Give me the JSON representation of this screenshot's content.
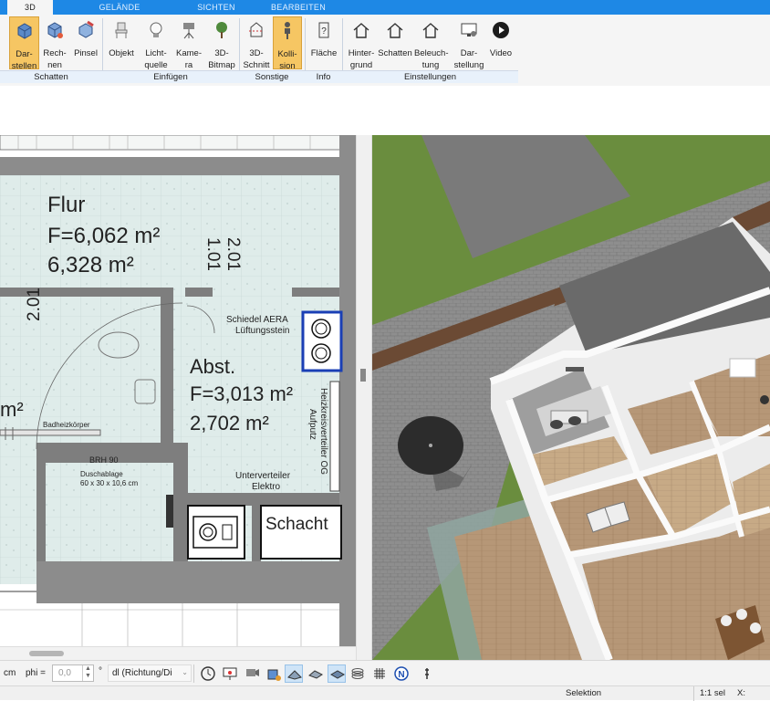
{
  "tabs": [
    {
      "label": "3D",
      "active": true
    },
    {
      "label": "GELÄNDE",
      "active": false
    },
    {
      "label": "SICHTEN",
      "active": false
    },
    {
      "label": "BEARBEITEN",
      "active": false
    }
  ],
  "ribbon": {
    "buttons": [
      {
        "label": "Dar-\nstellen",
        "icon": "cube-render-icon",
        "active": true
      },
      {
        "label": "Rech-\nnen",
        "icon": "cube-calc-icon",
        "active": false
      },
      {
        "label": "Pinsel",
        "icon": "brush-icon",
        "active": false
      },
      {
        "label": "Objekt",
        "icon": "chair-icon",
        "active": false
      },
      {
        "label": "Licht-\nquelle ▼",
        "icon": "bulb-icon",
        "active": false
      },
      {
        "label": "Kame-\nra",
        "icon": "camera-icon",
        "active": false
      },
      {
        "label": "3D-\nBitmap",
        "icon": "tree-icon",
        "active": false
      },
      {
        "label": "3D-\nSchnitt",
        "icon": "section-icon",
        "active": false
      },
      {
        "label": "Kolli-\nsion",
        "icon": "person-icon",
        "active": true
      },
      {
        "label": "Fläche",
        "icon": "area-icon",
        "active": false
      },
      {
        "label": "Hinter-\ngrund",
        "icon": "house-bg-icon",
        "active": false
      },
      {
        "label": "Schatten",
        "icon": "house-shadow-icon",
        "active": false
      },
      {
        "label": "Beleuch-\ntung",
        "icon": "house-light-icon",
        "active": false
      },
      {
        "label": "Dar-\nstellung",
        "icon": "monitor-icon",
        "active": false
      },
      {
        "label": "Video",
        "icon": "play-icon",
        "active": false
      }
    ],
    "groups": [
      "Schatten",
      "Einfügen",
      "Sonstige",
      "Info",
      "Einstellungen"
    ]
  },
  "plan": {
    "rooms": [
      {
        "name": "Flur",
        "area_f": "F=6,062 m²",
        "area": "6,328 m²"
      },
      {
        "name": "Abst.",
        "area_f": "F=3,013 m²",
        "area": "2,702 m²"
      }
    ],
    "dims": [
      "1.01",
      "2.01",
      "2.01"
    ],
    "partial_area": "m²",
    "labels": {
      "schiedel": "Schiedel AERA",
      "lueftung": "Lüftungsstein",
      "heizkreis": "Heizkreisverteiler OG",
      "aufputz": "Aufputz",
      "unterverteiler": "Unterverteiler",
      "elektro": "Elektro",
      "schacht": "Schacht",
      "badheizkoerper": "Badheizkörper",
      "brh": "BRH 90",
      "duschablage": "Duschablage",
      "duschablage_size": "60 x 30 x 10,6 cm"
    }
  },
  "toolbar": {
    "unit": "cm",
    "phi_label": "phi =",
    "phi_value": "0,0",
    "degree": "°",
    "direction_value": "dl (Richtung/Di",
    "icons": [
      "clock-icon",
      "presentation-icon",
      "camera-move-icon",
      "paint-bucket-icon",
      "plane-icon",
      "path-icon",
      "layer-icon",
      "stack-icon",
      "grid-icon",
      "north-icon",
      "pin-icon"
    ],
    "active_icons": [
      "plane-icon",
      "layer-icon"
    ]
  },
  "status": {
    "mode": "Selektion",
    "scale": "1:1 sel",
    "x": "X:"
  },
  "colors": {
    "accent": "#1e88e5",
    "active_button": "#f6c663",
    "wall": "#8c8c8c",
    "floor": "#dde9e8",
    "grass": "#6d8f3f"
  }
}
